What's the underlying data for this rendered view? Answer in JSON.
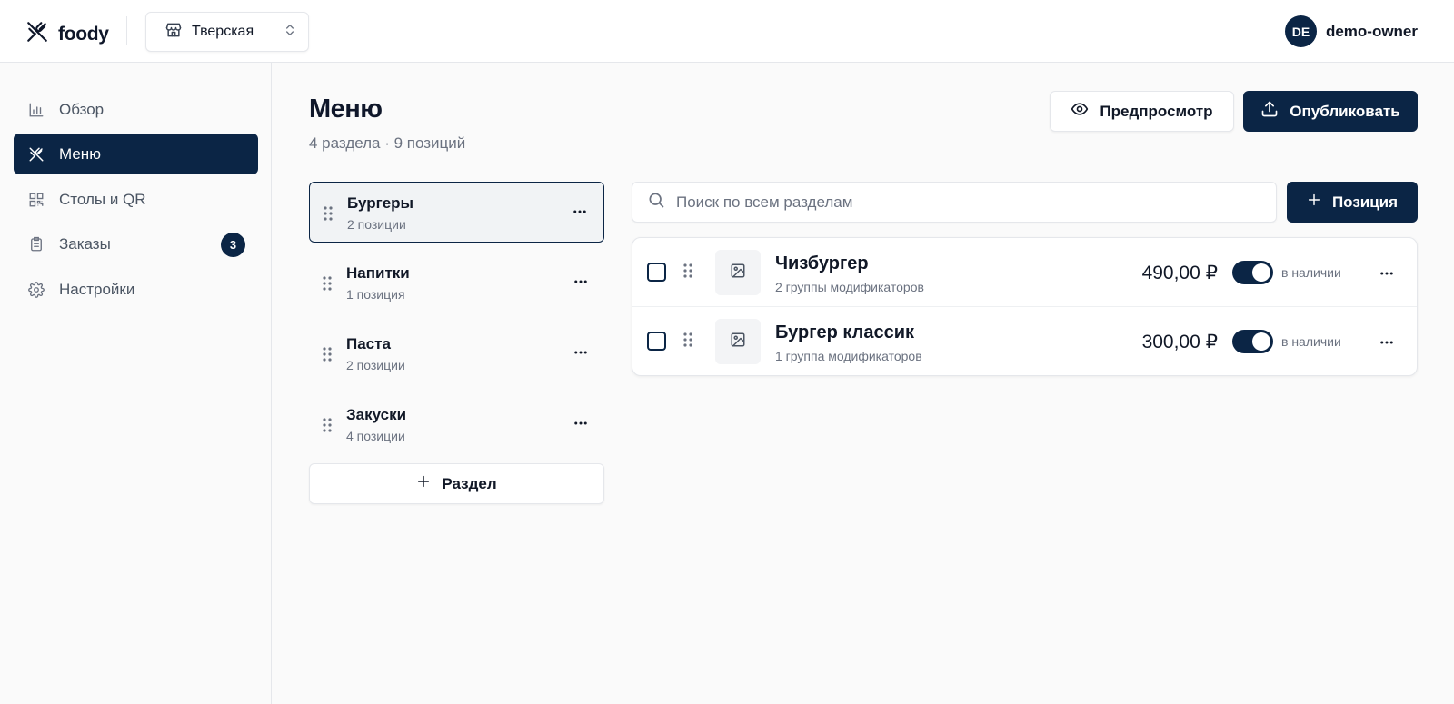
{
  "header": {
    "app_name": "foody",
    "location": "Тверская",
    "user": {
      "initials": "DE",
      "name": "demo-owner"
    }
  },
  "sidebar": {
    "items": [
      {
        "label": "Обзор",
        "icon": "bar-chart-icon",
        "active": false
      },
      {
        "label": "Меню",
        "icon": "utensils-icon",
        "active": true
      },
      {
        "label": "Столы и QR",
        "icon": "qr-code-icon",
        "active": false
      },
      {
        "label": "Заказы",
        "icon": "clipboard-icon",
        "active": false,
        "badge": "3"
      },
      {
        "label": "Настройки",
        "icon": "gear-icon",
        "active": false
      }
    ]
  },
  "page": {
    "title": "Меню",
    "subtitle": "4 раздела · 9 позиций",
    "preview_label": "Предпросмотр",
    "publish_label": "Опубликовать"
  },
  "sections": {
    "items": [
      {
        "name": "Бургеры",
        "count": "2 позиции",
        "active": true
      },
      {
        "name": "Напитки",
        "count": "1 позиция",
        "active": false
      },
      {
        "name": "Паста",
        "count": "2 позиции",
        "active": false
      },
      {
        "name": "Закуски",
        "count": "4 позиции",
        "active": false
      }
    ],
    "add_label": "Раздел"
  },
  "search": {
    "placeholder": "Поиск по всем разделам",
    "value": ""
  },
  "add_item_label": "Позиция",
  "items": [
    {
      "name": "Чизбургер",
      "modifiers": "2 группы модификаторов",
      "price": "490,00 ₽",
      "available": true,
      "availability_label": "в наличии"
    },
    {
      "name": "Бургер классик",
      "modifiers": "1 группа модификаторов",
      "price": "300,00 ₽",
      "available": true,
      "availability_label": "в наличии"
    }
  ],
  "colors": {
    "primary": "#0b2545",
    "border": "#e5e7eb",
    "muted_text": "#6b7280",
    "background": "#fafafa"
  }
}
